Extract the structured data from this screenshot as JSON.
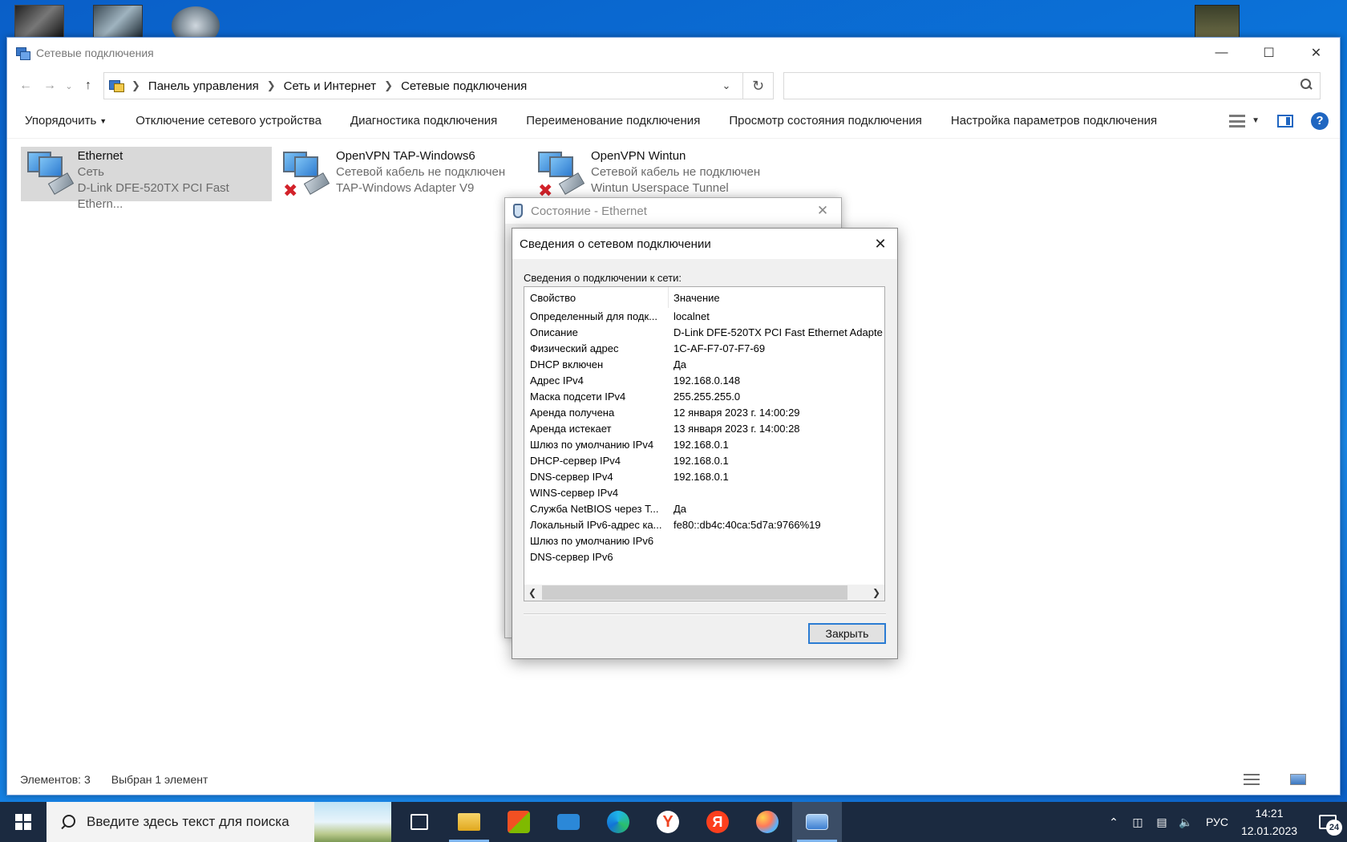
{
  "explorer": {
    "title": "Сетевые подключения",
    "breadcrumb": [
      "Панель управления",
      "Сеть и Интернет",
      "Сетевые подключения"
    ],
    "search_placeholder": "",
    "commands": {
      "organize": "Упорядочить",
      "disable": "Отключение сетевого устройства",
      "diagnose": "Диагностика подключения",
      "rename": "Переименование подключения",
      "view_status": "Просмотр состояния подключения",
      "settings": "Настройка параметров подключения"
    },
    "connections": [
      {
        "name": "Ethernet",
        "status": "Сеть",
        "adapter": "D-Link DFE-520TX PCI Fast Ethern...",
        "disconnected": false,
        "selected": true
      },
      {
        "name": "OpenVPN TAP-Windows6",
        "status": "Сетевой кабель не подключен",
        "adapter": "TAP-Windows Adapter V9",
        "disconnected": true,
        "selected": false
      },
      {
        "name": "OpenVPN Wintun",
        "status": "Сетевой кабель не подключен",
        "adapter": "Wintun Userspace Tunnel",
        "disconnected": true,
        "selected": false
      }
    ],
    "statusbar": {
      "items_count": "Элементов: 3",
      "selected": "Выбран 1 элемент"
    }
  },
  "status_dialog": {
    "title": "Состояние - Ethernet"
  },
  "details_dialog": {
    "title": "Сведения о сетевом подключении",
    "label": "Сведения о подключении к сети:",
    "columns": {
      "property": "Свойство",
      "value": "Значение"
    },
    "rows": [
      {
        "p": "Определенный для подк...",
        "v": "localnet"
      },
      {
        "p": "Описание",
        "v": "D-Link DFE-520TX PCI Fast Ethernet Adapte"
      },
      {
        "p": "Физический адрес",
        "v": "1C-AF-F7-07-F7-69"
      },
      {
        "p": "DHCP включен",
        "v": "Да"
      },
      {
        "p": "Адрес IPv4",
        "v": "192.168.0.148"
      },
      {
        "p": "Маска подсети IPv4",
        "v": "255.255.255.0"
      },
      {
        "p": "Аренда получена",
        "v": "12 января 2023 г. 14:00:29"
      },
      {
        "p": "Аренда истекает",
        "v": "13 января 2023 г. 14:00:28"
      },
      {
        "p": "Шлюз по умолчанию IPv4",
        "v": "192.168.0.1"
      },
      {
        "p": "DHCP-сервер IPv4",
        "v": "192.168.0.1"
      },
      {
        "p": "DNS-сервер IPv4",
        "v": "192.168.0.1"
      },
      {
        "p": "WINS-сервер IPv4",
        "v": ""
      },
      {
        "p": "Служба NetBIOS через Т...",
        "v": "Да"
      },
      {
        "p": "Локальный IPv6-адрес ка...",
        "v": "fe80::db4c:40ca:5d7a:9766%19"
      },
      {
        "p": "Шлюз по умолчанию IPv6",
        "v": ""
      },
      {
        "p": "DNS-сервер IPv6",
        "v": ""
      }
    ],
    "close_button": "Закрыть"
  },
  "taskbar": {
    "search_text": "Введите здесь текст для поиска",
    "language": "РУС",
    "time": "14:21",
    "date": "12.01.2023",
    "notification_count": "24"
  }
}
